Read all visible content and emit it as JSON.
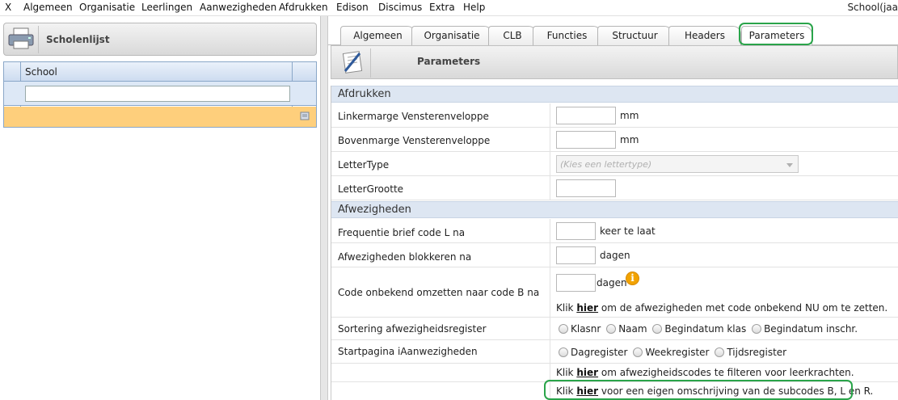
{
  "menu": {
    "items": [
      "X",
      "Algemeen",
      "Organisatie",
      "Leerlingen",
      "Aanwezigheden",
      "Afdrukken",
      "Edison",
      "Discimus",
      "Extra",
      "Help"
    ],
    "right_text": "School(jaa"
  },
  "left": {
    "title": "Scholenlijst",
    "column_header": "School",
    "filter_value": ""
  },
  "tabs": [
    "Algemeen",
    "Organisatie",
    "CLB",
    "Functies",
    "Structuur",
    "Headers",
    "Parameters"
  ],
  "active_tab": "Parameters",
  "content": {
    "title": "Parameters",
    "sections": {
      "afdrukken": "Afdrukken",
      "afwezigheden": "Afwezigheden"
    },
    "rows": {
      "linkermarge": {
        "label": "Linkermarge Vensterenveloppe",
        "value": "",
        "unit": "mm"
      },
      "bovenmarge": {
        "label": "Bovenmarge Vensterenveloppe",
        "value": "",
        "unit": "mm"
      },
      "lettertype": {
        "label": "LetterType",
        "placeholder": "(Kies een lettertype)"
      },
      "lettergrootte": {
        "label": "LetterGrootte",
        "value": ""
      },
      "frequentie": {
        "label": "Frequentie brief code L na",
        "value": "",
        "unit": "keer te laat"
      },
      "blokkeren": {
        "label": "Afwezigheden blokkeren na",
        "value": "",
        "unit": "dagen"
      },
      "code_onbekend": {
        "label": "Code onbekend omzetten naar code B na",
        "value": "",
        "unit": "dagen",
        "link_prefix": "Klik",
        "link_text": "hier",
        "link_suffix": "om de afwezigheden met code onbekend NU om te zetten."
      },
      "sortering": {
        "label": "Sortering afwezigheidsregister",
        "options": [
          "Klasnr",
          "Naam",
          "Begindatum klas",
          "Begindatum inschr."
        ]
      },
      "startpagina": {
        "label": "Startpagina iAanwezigheden",
        "options": [
          "Dagregister",
          "Weekregister",
          "Tijdsregister"
        ]
      },
      "filter_link": {
        "prefix": "Klik",
        "link": "hier",
        "suffix": "om afwezigheidscodes te filteren voor leerkrachten."
      },
      "omschrijving_link": {
        "prefix": "Klik",
        "link": "hier",
        "suffix": "voor een eigen omschrijving van de subcodes B, L en R."
      }
    }
  },
  "colors": {
    "highlight": "#2aa44a",
    "footer": "#fecf7c",
    "section_bg": "#dde6f2",
    "info": "#f2a300"
  },
  "icons": {
    "printer": "printer-icon",
    "notepad": "notepad-edit-icon",
    "info": "info-icon",
    "page": "page-icon"
  }
}
